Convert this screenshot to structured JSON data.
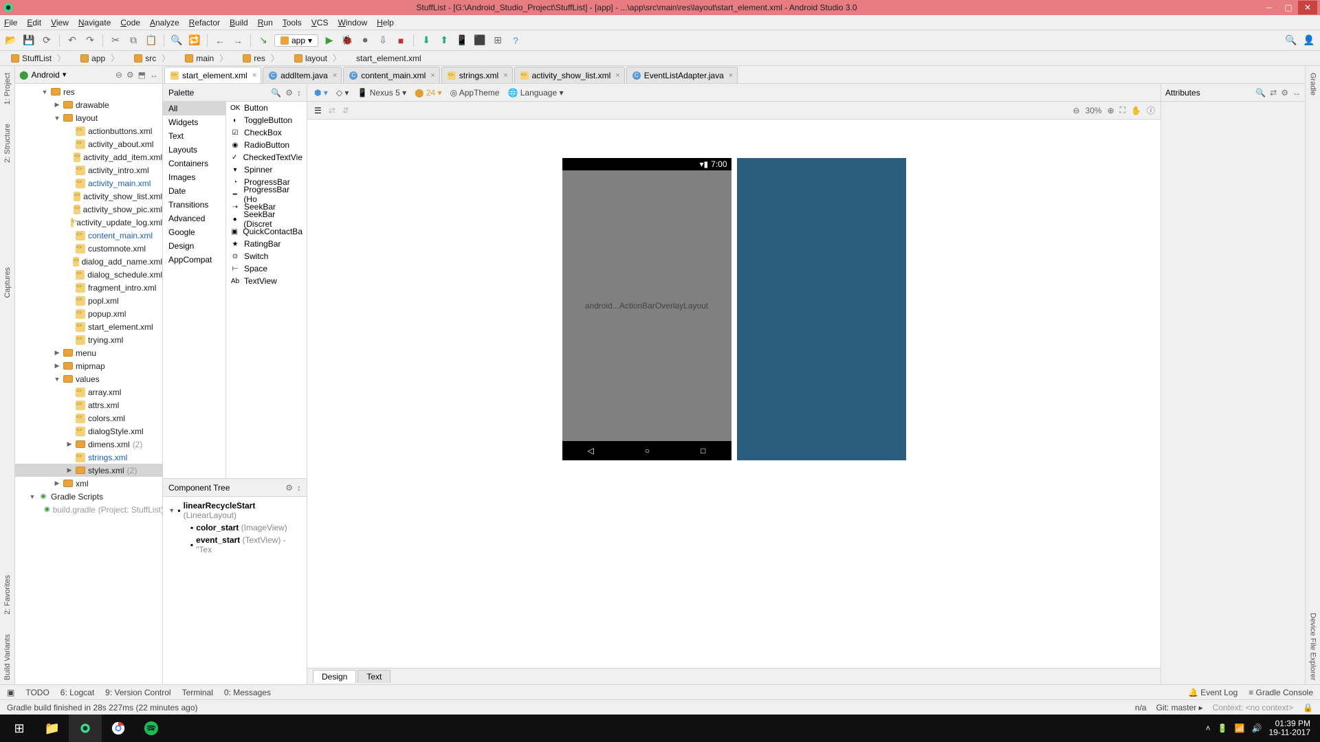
{
  "title": "StuffList - [G:\\Android_Studio_Project\\StuffList] - [app] - ...\\app\\src\\main\\res\\layout\\start_element.xml - Android Studio 3.0",
  "menu": [
    "File",
    "Edit",
    "View",
    "Navigate",
    "Code",
    "Analyze",
    "Refactor",
    "Build",
    "Run",
    "Tools",
    "VCS",
    "Window",
    "Help"
  ],
  "toolbar_module": "app",
  "breadcrumb": [
    "StuffList",
    "app",
    "src",
    "main",
    "res",
    "layout",
    "start_element.xml"
  ],
  "project": {
    "header": "Android",
    "tree": [
      {
        "indent": 2,
        "arrow": "▼",
        "icon": "fold",
        "label": "res"
      },
      {
        "indent": 3,
        "arrow": "▶",
        "icon": "fold",
        "label": "drawable"
      },
      {
        "indent": 3,
        "arrow": "▼",
        "icon": "fold",
        "label": "layout"
      },
      {
        "indent": 4,
        "icon": "xml",
        "label": "actionbuttons.xml"
      },
      {
        "indent": 4,
        "icon": "xml",
        "label": "activity_about.xml"
      },
      {
        "indent": 4,
        "icon": "xml",
        "label": "activity_add_item.xml"
      },
      {
        "indent": 4,
        "icon": "xml",
        "label": "activity_intro.xml"
      },
      {
        "indent": 4,
        "icon": "xml",
        "label": "activity_main.xml",
        "blue": true
      },
      {
        "indent": 4,
        "icon": "xml",
        "label": "activity_show_list.xml"
      },
      {
        "indent": 4,
        "icon": "xml",
        "label": "activity_show_pic.xml"
      },
      {
        "indent": 4,
        "icon": "xml",
        "label": "activity_update_log.xml"
      },
      {
        "indent": 4,
        "icon": "xml",
        "label": "content_main.xml",
        "blue": true
      },
      {
        "indent": 4,
        "icon": "xml",
        "label": "customnote.xml"
      },
      {
        "indent": 4,
        "icon": "xml",
        "label": "dialog_add_name.xml"
      },
      {
        "indent": 4,
        "icon": "xml",
        "label": "dialog_schedule.xml"
      },
      {
        "indent": 4,
        "icon": "xml",
        "label": "fragment_intro.xml"
      },
      {
        "indent": 4,
        "icon": "xml",
        "label": "popl.xml"
      },
      {
        "indent": 4,
        "icon": "xml",
        "label": "popup.xml"
      },
      {
        "indent": 4,
        "icon": "xml",
        "label": "start_element.xml"
      },
      {
        "indent": 4,
        "icon": "xml",
        "label": "trying.xml"
      },
      {
        "indent": 3,
        "arrow": "▶",
        "icon": "fold",
        "label": "menu"
      },
      {
        "indent": 3,
        "arrow": "▶",
        "icon": "fold",
        "label": "mipmap"
      },
      {
        "indent": 3,
        "arrow": "▼",
        "icon": "fold",
        "label": "values"
      },
      {
        "indent": 4,
        "icon": "xml",
        "label": "array.xml"
      },
      {
        "indent": 4,
        "icon": "xml",
        "label": "attrs.xml"
      },
      {
        "indent": 4,
        "icon": "xml",
        "label": "colors.xml"
      },
      {
        "indent": 4,
        "icon": "xml",
        "label": "dialogStyle.xml"
      },
      {
        "indent": 4,
        "arrow": "▶",
        "icon": "fold",
        "label": "dimens.xml",
        "suffix": "(2)"
      },
      {
        "indent": 4,
        "icon": "xml",
        "label": "strings.xml",
        "blue": true
      },
      {
        "indent": 4,
        "arrow": "▶",
        "icon": "fold",
        "label": "styles.xml",
        "suffix": "(2)",
        "selected": true
      },
      {
        "indent": 3,
        "arrow": "▶",
        "icon": "fold",
        "label": "xml"
      },
      {
        "indent": 1,
        "arrow": "▼",
        "icon": "gradle",
        "label": "Gradle Scripts"
      },
      {
        "indent": 2,
        "icon": "gradle",
        "label": "build.gradle",
        "suffix": "(Project: StuffList)",
        "gray": true
      }
    ]
  },
  "tabs": [
    {
      "icon": "xml",
      "label": "start_element.xml",
      "active": true
    },
    {
      "icon": "java",
      "label": "addItem.java"
    },
    {
      "icon": "java",
      "label": "content_main.xml"
    },
    {
      "icon": "xml",
      "label": "strings.xml"
    },
    {
      "icon": "xml",
      "label": "activity_show_list.xml"
    },
    {
      "icon": "java",
      "label": "EventListAdapter.java"
    }
  ],
  "palette": {
    "title": "Palette",
    "cats": [
      "All",
      "Widgets",
      "Text",
      "Layouts",
      "Containers",
      "Images",
      "Date",
      "Transitions",
      "Advanced",
      "Google",
      "Design",
      "AppCompat"
    ],
    "cat_selected": "All",
    "items": [
      "Button",
      "ToggleButton",
      "CheckBox",
      "RadioButton",
      "CheckedTextVie",
      "Spinner",
      "ProgressBar",
      "ProgressBar (Ho",
      "SeekBar",
      "SeekBar (Discret",
      "QuickContactBa",
      "RatingBar",
      "Switch",
      "Space",
      "TextView"
    ]
  },
  "component_tree": {
    "title": "Component Tree",
    "items": [
      {
        "indent": 0,
        "arrow": "▼",
        "bold": "linearRecycleStart",
        "gray": "(LinearLayout)"
      },
      {
        "indent": 1,
        "bold": "color_start",
        "gray": "(ImageView)"
      },
      {
        "indent": 1,
        "bold": "event_start",
        "gray": "(TextView) - \"Tex"
      }
    ]
  },
  "canvas_toolbar": {
    "device": "Nexus 5",
    "api": "24",
    "theme": "AppTheme",
    "lang": "Language",
    "zoom": "30%"
  },
  "preview": {
    "status_time": "7:00",
    "overlay_text": "android...ActionBarOverlayLayout"
  },
  "design_tabs": [
    "Design",
    "Text"
  ],
  "attrs_title": "Attributes",
  "left_tabs": [
    "1: Project",
    "2: Structure",
    "Captures"
  ],
  "right_tabs": [
    "Gradle",
    "Device File Explorer"
  ],
  "favorites_tab": "2: Favorites",
  "build_variants_tab": "Build Variants",
  "bottom_buttons": [
    "TODO",
    "6: Logcat",
    "9: Version Control",
    "Terminal",
    "0: Messages"
  ],
  "bottom_right": [
    "Event Log",
    "Gradle Console"
  ],
  "status_text": "Gradle build finished in 28s 227ms (22 minutes ago)",
  "status_right": {
    "na": "n/a",
    "git": "Git: master",
    "context": "Context: <no context>"
  },
  "clock": {
    "time": "01:39 PM",
    "date": "19-11-2017"
  }
}
